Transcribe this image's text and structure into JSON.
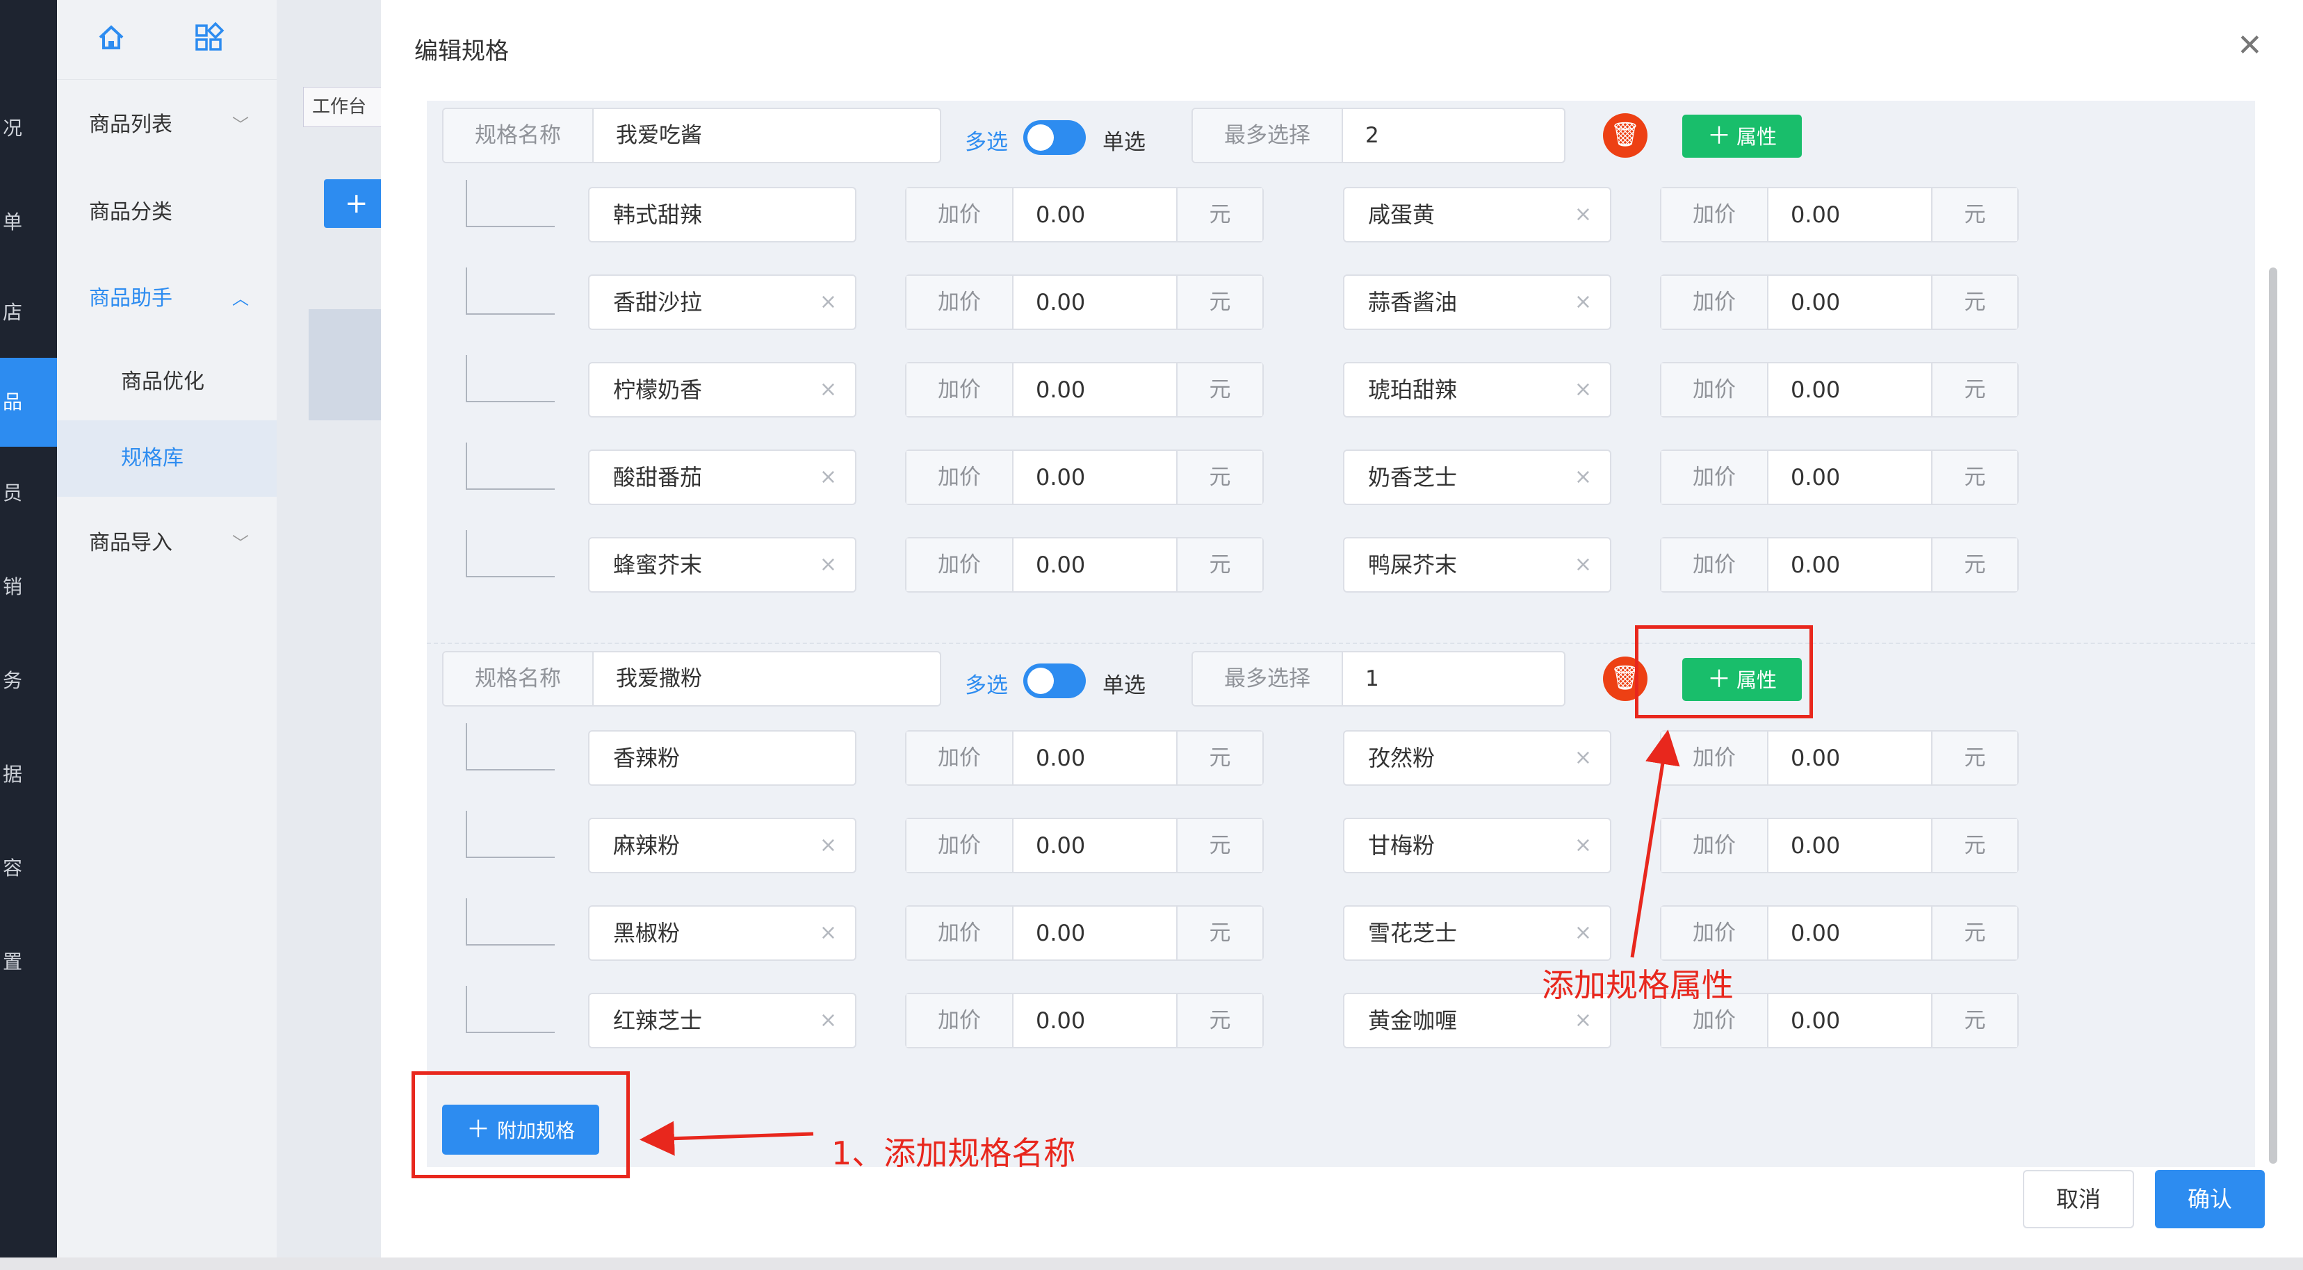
{
  "colors": {
    "primary": "#2d8cf0",
    "success": "#19be6b",
    "danger": "#ed4014",
    "annotation": "#e8271d"
  },
  "darknav": {
    "items": [
      "况",
      "单",
      "店",
      "品",
      "员",
      "销",
      "务",
      "据",
      "容",
      "置"
    ],
    "active_index": 3
  },
  "subnav": {
    "top_icons": [
      "home-icon",
      "apps-icon",
      "arrow-right-circle-icon"
    ],
    "items": [
      {
        "label": "商品列表",
        "chevron": "﹀"
      },
      {
        "label": "商品分类"
      },
      {
        "label": "商品助手",
        "chevron": "︿"
      },
      {
        "label": "商品优化"
      },
      {
        "label": "规格库"
      },
      {
        "label": "商品导入",
        "chevron": "﹀"
      }
    ]
  },
  "background": {
    "tab_label": "工作台",
    "plus_label": "+"
  },
  "modal": {
    "title": "编辑规格",
    "close_label": "✕",
    "spec_name_label": "规格名称",
    "multi_label": "多选",
    "single_label": "单选",
    "max_select_label": "最多选择",
    "add_price_label": "加价",
    "unit_label": "元",
    "attr_button_label": "属性",
    "delete_icon_label": "🗑",
    "clear_label": "×",
    "groups": [
      {
        "name": "我爱吃酱",
        "max_select": "2",
        "options": [
          [
            "韩式甜辣",
            "0.00",
            "咸蛋黄",
            "0.00"
          ],
          [
            "香甜沙拉",
            "0.00",
            "蒜香酱油",
            "0.00"
          ],
          [
            "柠檬奶香",
            "0.00",
            "琥珀甜辣",
            "0.00"
          ],
          [
            "酸甜番茄",
            "0.00",
            "奶香芝士",
            "0.00"
          ],
          [
            "蜂蜜芥末",
            "0.00",
            "鸭屎芥末",
            "0.00"
          ]
        ]
      },
      {
        "name": "我爱撒粉",
        "max_select": "1",
        "options": [
          [
            "香辣粉",
            "0.00",
            "孜然粉",
            "0.00"
          ],
          [
            "麻辣粉",
            "0.00",
            "甘梅粉",
            "0.00"
          ],
          [
            "黑椒粉",
            "0.00",
            "雪花芝士",
            "0.00"
          ],
          [
            "红辣芝士",
            "0.00",
            "黄金咖喱",
            "0.00"
          ]
        ]
      }
    ],
    "add_spec_label": "附加规格",
    "cancel_label": "取消",
    "confirm_label": "确认"
  },
  "annotations": {
    "add_attr": "添加规格属性",
    "add_spec": "1、添加规格名称"
  }
}
